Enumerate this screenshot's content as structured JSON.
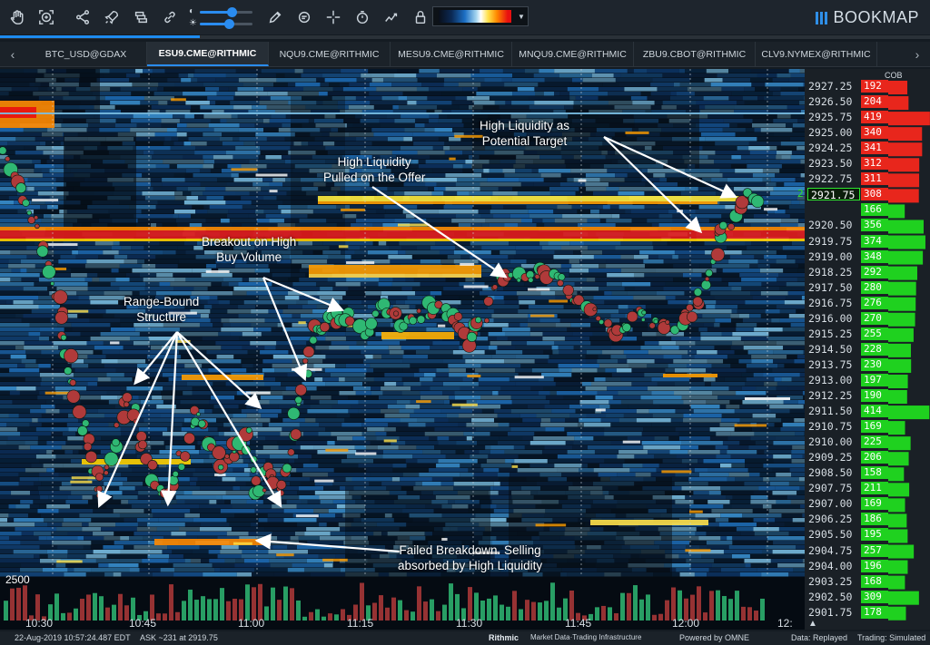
{
  "toolbar": {
    "icons": [
      "hand-icon",
      "zoom-fit-icon",
      "share-icon",
      "rocket-icon",
      "layers-icon",
      "link-icon",
      "pencil-icon",
      "chat-icon",
      "crosshair-icon",
      "timer-icon",
      "indicator-icon",
      "lock-icon"
    ],
    "contrast_level": 0.6,
    "brightness_level": 0.55,
    "contrast_symbol": "◐",
    "brightness_symbol": "☀",
    "heatmap_caret": "▼"
  },
  "brand": {
    "name": "BOOKMAP"
  },
  "progress": {
    "fraction": 0.215
  },
  "tabs": {
    "prev": "‹",
    "next": "›",
    "items": [
      {
        "label": "BTC_USD@GDAX",
        "active": false
      },
      {
        "label": "ESU9.CME@RITHMIC",
        "active": true
      },
      {
        "label": "NQU9.CME@RITHMIC",
        "active": false
      },
      {
        "label": "MESU9.CME@RITHMIC",
        "active": false
      },
      {
        "label": "MNQU9.CME@RITHMIC",
        "active": false
      },
      {
        "label": "ZBU9.CBOT@RITHMIC",
        "active": false
      },
      {
        "label": "CLV9.NYMEX@RITHMIC",
        "active": false
      }
    ]
  },
  "price_axis": {
    "cob_label": "COB",
    "current_price": "2921.75",
    "current_marker": "2",
    "rows": [
      {
        "price": "2927.25",
        "cob": "192",
        "side": "ask"
      },
      {
        "price": "2926.50",
        "cob": "204",
        "side": "ask"
      },
      {
        "price": "2925.75",
        "cob": "419",
        "side": "ask"
      },
      {
        "price": "2925.00",
        "cob": "340",
        "side": "ask"
      },
      {
        "price": "2924.25",
        "cob": "341",
        "side": "ask"
      },
      {
        "price": "2923.50",
        "cob": "312",
        "side": "ask"
      },
      {
        "price": "2922.75",
        "cob": "311",
        "side": "ask"
      },
      {
        "price": "2921.75",
        "cob": "308",
        "side": "ask"
      },
      {
        "price": "",
        "cob": "166",
        "side": "bid"
      },
      {
        "price": "2920.50",
        "cob": "356",
        "side": "bid"
      },
      {
        "price": "2919.75",
        "cob": "374",
        "side": "bid"
      },
      {
        "price": "2919.00",
        "cob": "348",
        "side": "bid"
      },
      {
        "price": "2918.25",
        "cob": "292",
        "side": "bid"
      },
      {
        "price": "2917.50",
        "cob": "280",
        "side": "bid"
      },
      {
        "price": "2916.75",
        "cob": "276",
        "side": "bid"
      },
      {
        "price": "2916.00",
        "cob": "270",
        "side": "bid"
      },
      {
        "price": "2915.25",
        "cob": "255",
        "side": "bid"
      },
      {
        "price": "2914.50",
        "cob": "228",
        "side": "bid"
      },
      {
        "price": "2913.75",
        "cob": "230",
        "side": "bid"
      },
      {
        "price": "2913.00",
        "cob": "197",
        "side": "bid"
      },
      {
        "price": "2912.25",
        "cob": "190",
        "side": "bid"
      },
      {
        "price": "2911.50",
        "cob": "414",
        "side": "bid"
      },
      {
        "price": "2910.75",
        "cob": "169",
        "side": "bid"
      },
      {
        "price": "2910.00",
        "cob": "225",
        "side": "bid"
      },
      {
        "price": "2909.25",
        "cob": "206",
        "side": "bid"
      },
      {
        "price": "2908.50",
        "cob": "158",
        "side": "bid"
      },
      {
        "price": "2907.75",
        "cob": "211",
        "side": "bid"
      },
      {
        "price": "2907.00",
        "cob": "169",
        "side": "bid"
      },
      {
        "price": "2906.25",
        "cob": "186",
        "side": "bid"
      },
      {
        "price": "2905.50",
        "cob": "195",
        "side": "bid"
      },
      {
        "price": "2904.75",
        "cob": "257",
        "side": "bid"
      },
      {
        "price": "2904.00",
        "cob": "196",
        "side": "bid"
      },
      {
        "price": "2903.25",
        "cob": "168",
        "side": "bid"
      },
      {
        "price": "2902.50",
        "cob": "309",
        "side": "bid"
      },
      {
        "price": "2901.75",
        "cob": "178",
        "side": "bid"
      }
    ]
  },
  "time_axis": {
    "labels": [
      "10:30",
      "10:45",
      "11:00",
      "11:15",
      "11:30",
      "11:45",
      "12:00",
      "12:"
    ],
    "collapse": "▲"
  },
  "volume_label": "2500",
  "annotations": [
    {
      "id": "range",
      "lines": [
        "Range-Bound",
        "Structure"
      ]
    },
    {
      "id": "breakout",
      "lines": [
        "Breakout on High",
        "Buy Volume"
      ]
    },
    {
      "id": "pulled",
      "lines": [
        "High Liquidity",
        "Pulled on the Offer"
      ]
    },
    {
      "id": "target",
      "lines": [
        "High Liquidity as",
        "Potential Target"
      ]
    },
    {
      "id": "failed",
      "lines": [
        "Failed Breakdown. Selling",
        "absorbed by High Liquidity"
      ]
    }
  ],
  "statusbar": {
    "datetime": "22-Aug-2019 10:57:24.487 EDT",
    "ask": "ASK ~231 at 2919.75",
    "provider": "Rithmic",
    "provider_sub": "Market Data·Trading Infrastructure",
    "powered": "Powered by OMNE",
    "data_mode": "Data: Replayed",
    "trading_mode": "Trading: Simulated"
  },
  "colors": {
    "accent": "#2a8cf0",
    "ask": "#e8261c",
    "bid": "#1fd11f",
    "buy_dot": "#2fb873",
    "sell_dot": "#b03a3a"
  }
}
